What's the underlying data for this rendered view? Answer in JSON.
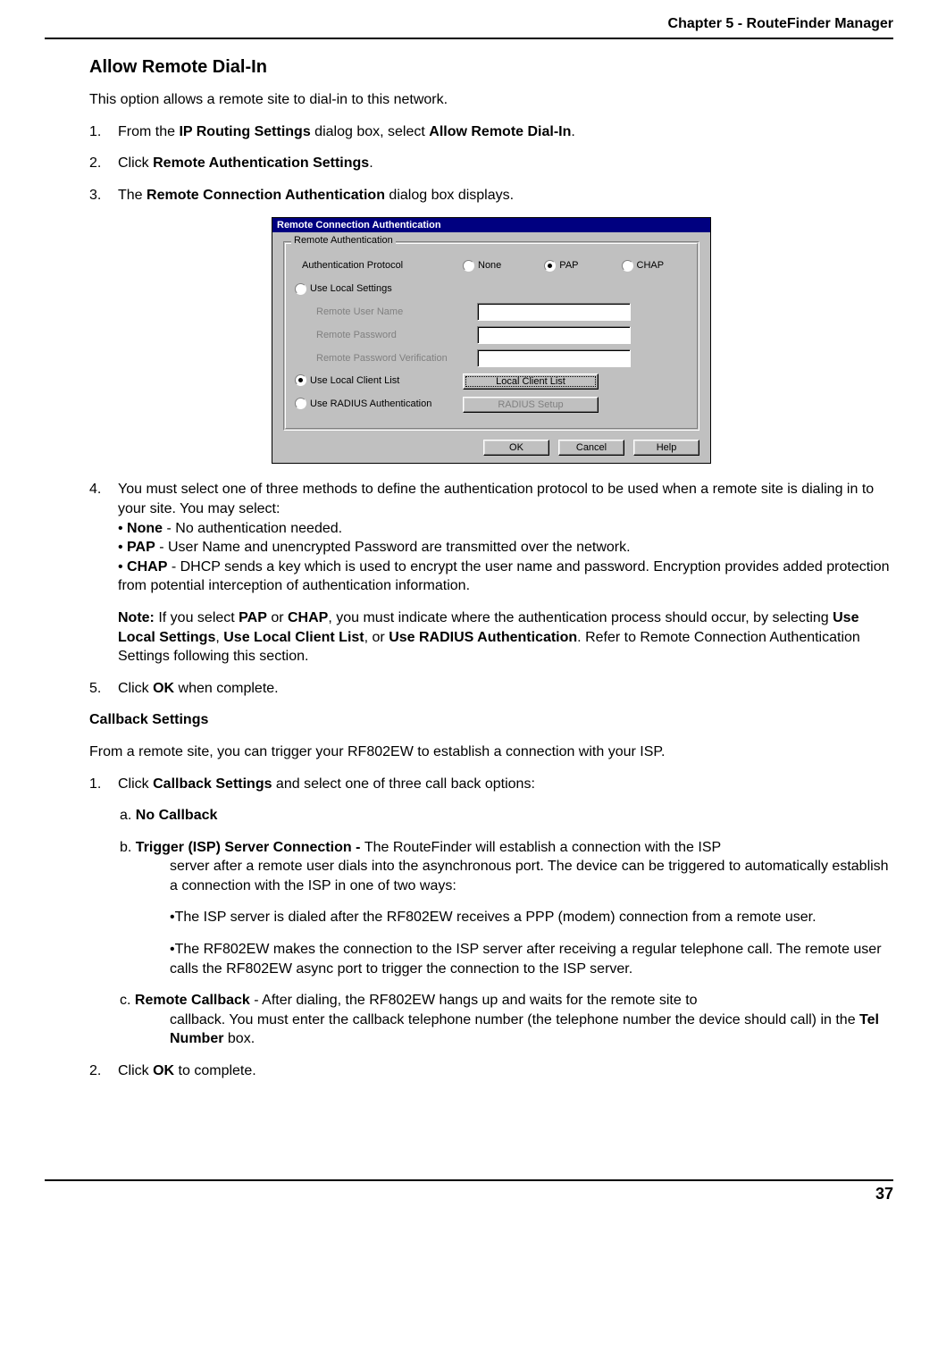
{
  "header": {
    "chapter": "Chapter 5 - RouteFinder Manager"
  },
  "section": {
    "title": "Allow Remote Dial-In",
    "intro": "This option allows a remote site to dial-in to this network.",
    "step1": {
      "num": "1.",
      "pre": "From the ",
      "b1": "IP Routing Settings",
      "mid": " dialog box, select ",
      "b2": "Allow Remote Dial-In",
      "end": "."
    },
    "step2": {
      "num": "2.",
      "pre": "Click ",
      "b1": "Remote Authentication Settings",
      "end": "."
    },
    "step3": {
      "num": "3.",
      "pre": "The ",
      "b1": "Remote Connection Authentication",
      "end": " dialog box displays."
    },
    "step4": {
      "num": "4.",
      "intro": " You must select one of three methods to define the authentication protocol to be used when a remote site is dialing in to your site.  You may select:",
      "bullet_none_pre": "• ",
      "bullet_none_b": "None",
      "bullet_none_rest": " - No authentication needed.",
      "bullet_pap_pre": "• ",
      "bullet_pap_b": "PAP",
      "bullet_pap_rest": " - User Name and unencrypted Password are transmitted over the network.",
      "bullet_chap_pre": "• ",
      "bullet_chap_b": "CHAP",
      "bullet_chap_rest": " - DHCP sends a key which is used to encrypt the user name and password.  Encryption provides added protection from potential interception of authentication information.",
      "note_label": "Note:",
      "note_1": " If you select ",
      "note_b1": "PAP",
      "note_2": " or ",
      "note_b2": "CHAP",
      "note_3": ", you must indicate where the authentication process should occur, by selecting ",
      "note_b3": "Use Local Settings",
      "note_4": ", ",
      "note_b4": "Use Local Client List",
      "note_5": ", or ",
      "note_b5": "Use RADIUS Authentication",
      "note_6": ".  Refer to Remote Connection Authentication Settings following this section."
    },
    "step5": {
      "num": "5.",
      "pre": "Click ",
      "b1": "OK",
      "end": " when complete."
    },
    "callback_heading": "Callback Settings",
    "callback_intro": "From a remote site, you can trigger your RF802EW to establish a connection with your ISP.",
    "cb_step1": {
      "num": "1.",
      "pre": "Click ",
      "b1": "Callback Settings",
      "end": " and select one of three call back options:"
    },
    "cb_a": {
      "pre": "a. ",
      "b": "No Callback"
    },
    "cb_b": {
      "pre": "b. ",
      "b": "Trigger (ISP) Server Connection - ",
      "rest": "The RouteFinder will establish a connection with the ISP server after a remote user dials into the asynchronous port.  The device can be triggered to automatically establish a connection with the ISP in one of two ways:",
      "bullet1": "•The ISP server is dialed after the RF802EW receives a PPP (modem) connection from a remote  user.",
      "bullet2": "•The RF802EW makes the connection to the ISP server after receiving a regular telephone call.  The remote user calls the RF802EW async port to trigger the connection to the ISP server."
    },
    "cb_c": {
      "pre": "c. ",
      "b": "Remote Callback ",
      "rest1": "- After dialing, the RF802EW hangs up and waits for the remote site to callback.  You must enter the callback telephone number (the telephone number the device should call) in the ",
      "b2": "Tel Number",
      "rest2": " box."
    },
    "cb_step2": {
      "num": "2.",
      "pre": "Click ",
      "b1": "OK",
      "end": " to complete."
    }
  },
  "dialog": {
    "title": "Remote Connection Authentication",
    "group": "Remote Authentication",
    "auth_label": "Authentication Protocol",
    "radio_none": "None",
    "radio_pap": "PAP",
    "radio_chap": "CHAP",
    "use_local_settings": "Use Local Settings",
    "remote_user": "Remote User Name",
    "remote_pass": "Remote Password",
    "remote_pass_verify": "Remote Password Verification",
    "use_local_client": "Use Local Client List",
    "use_radius": "Use RADIUS Authentication",
    "btn_local_client": "Local Client List",
    "btn_radius": "RADIUS Setup",
    "btn_ok": "OK",
    "btn_cancel": "Cancel",
    "btn_help": "Help"
  },
  "footer": {
    "page": "37"
  }
}
